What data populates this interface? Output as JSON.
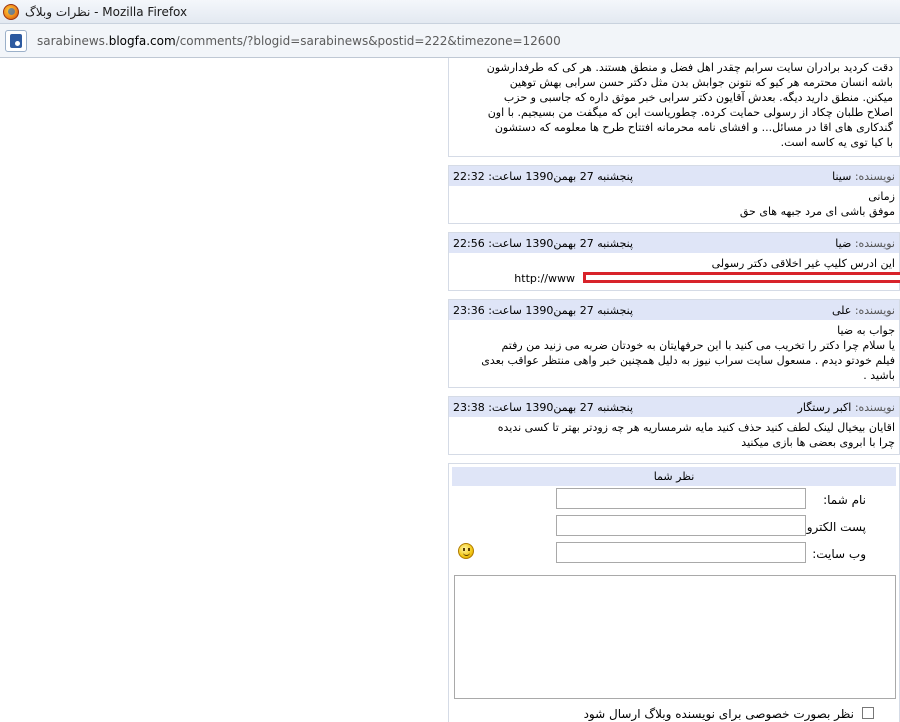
{
  "window": {
    "title": "نظرات وبلاگ - Mozilla Firefox"
  },
  "address": {
    "domain_prefix": "sarabinews.",
    "domain_main": "blogfa.com",
    "path": "/comments/?blogid=sarabinews&postid=222&timezone=12600"
  },
  "comments_first_body": [
    "دقت کردید برادران سایت سرابم چقدر اهل فضل و منطق هستند. هر کی که طرفدارشون",
    "باشه انسان محترمه هر کیو که نتونن جوابش بدن مثل دکتر حسن سرابی بهش توهین",
    "میکنن. منطق دارید دیگه. بعدش آقایون دکتر سرابی خبر موثق داره که جاسبی و حزب",
    "اصلاح طلبان چکاد از رسولی حمایت کرده. چطوریاست این که میگفت من بسیجیم. با اون",
    "گندکاری های اقا در مسائل... و افشای نامه محرمانه افتتاح طرح ها معلومه که دستشون",
    "با کیا توی یه کاسه است."
  ],
  "comments": [
    {
      "author_label": "نویسنده:",
      "author": "سینا",
      "date": "پنجشنبه 27 بهمن1390 ساعت: 22:32",
      "lines": [
        "زمانی",
        "موفق باشی ای مرد جبهه های حق"
      ]
    },
    {
      "author_label": "نویسنده:",
      "author": "ضیا",
      "date": "پنجشنبه 27 بهمن1390 ساعت: 22:56",
      "lines": [
        "این ادرس کلیپ غیر اخلاقی دکتر رسولی"
      ],
      "link_text": "http://www"
    },
    {
      "author_label": "نویسنده:",
      "author": "علی",
      "date": "پنجشنبه 27 بهمن1390 ساعت: 23:36",
      "lines": [
        "جواب به ضیا",
        "یا سلام چرا دکتر را تخریب می کنید با این حرفهایتان به خودتان ضربه می زنید من رفتم",
        "فیلم خودتو دیدم . مسعول سایت سراب نیوز به دلیل همچنین خبر واهی منتظر عواقب بعدی",
        "باشید ."
      ]
    },
    {
      "author_label": "نویسنده:",
      "author": "اکبر رستگار",
      "date": "پنجشنبه 27 بهمن1390 ساعت: 23:38",
      "lines": [
        "اقایان بیخیال لینک لطف کنید حذف کنید مایه شرمساریه هر چه زودتر بهتر تا کسی ندیده",
        "چرا با ابروی بعضی ها بازی میکنید"
      ]
    }
  ],
  "form": {
    "title": "نظر شما",
    "name_label": "نام شما:",
    "email_label": "پست الکترونیک:",
    "website_label": "وب سایت:",
    "private_label": "نظر بصورت خصوصی برای نویسنده وبلاگ ارسال شود"
  }
}
